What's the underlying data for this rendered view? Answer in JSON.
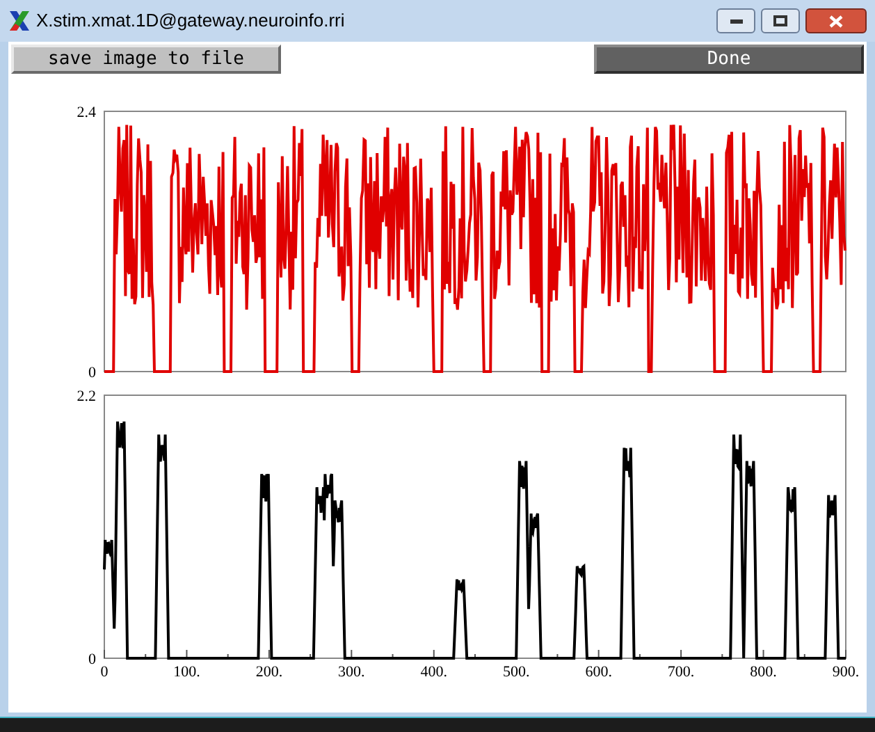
{
  "window": {
    "title": "X.stim.xmat.1D@gateway.neuroinfo.rri"
  },
  "buttons": [
    {
      "label": "save image to file",
      "kind": "light"
    },
    {
      "label": "Done",
      "kind": "dark"
    }
  ],
  "plots": [
    {
      "kind": "bursts",
      "color": "#e00000",
      "y_ticks": [
        "2.4",
        "0"
      ]
    },
    {
      "kind": "peaks",
      "color": "#000000",
      "y_ticks": [
        "2.2",
        "0"
      ],
      "x_ticks": [
        "0",
        "100.",
        "200.",
        "300.",
        "400.",
        "500.",
        "600.",
        "700.",
        "800.",
        "900."
      ]
    }
  ]
}
